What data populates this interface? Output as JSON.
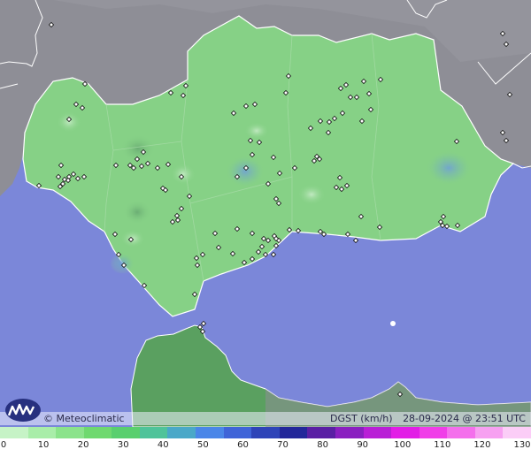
{
  "map": {
    "brand": "© Meteoclimatic",
    "variable": "DGST (km/h)",
    "timestamp": "28-09-2024 @ 23:51 UTC",
    "colors": {
      "sea": "#7b87d9",
      "land_outside": "#8e8e96",
      "andalusia": "#86d186",
      "morocco": "#5aa060",
      "border": "#ffffff"
    }
  },
  "scale": {
    "tick_labels": [
      "0",
      "10",
      "20",
      "30",
      "40",
      "50",
      "60",
      "70",
      "80",
      "90",
      "100",
      "110",
      "120",
      "130"
    ],
    "colors": [
      "#c6f3c6",
      "#a9eda9",
      "#8be38b",
      "#6fd96f",
      "#59cf6e",
      "#4fc39a",
      "#4aa8c8",
      "#4a86e8",
      "#3f64d8",
      "#2e44b8",
      "#23279a",
      "#5a1fa4",
      "#8a1fc0",
      "#b91fd6",
      "#e21ee6",
      "#f03ee8",
      "#f46fec",
      "#f7a0f1",
      "#fbcdf7"
    ]
  },
  "stations": {
    "count": 123
  }
}
